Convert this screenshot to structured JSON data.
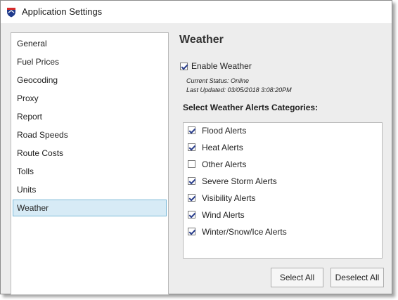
{
  "window": {
    "title": "Application Settings",
    "icon": "shield-logo-icon"
  },
  "sidebar": {
    "items": [
      {
        "label": "General",
        "selected": false
      },
      {
        "label": "Fuel Prices",
        "selected": false
      },
      {
        "label": "Geocoding",
        "selected": false
      },
      {
        "label": "Proxy",
        "selected": false
      },
      {
        "label": "Report",
        "selected": false
      },
      {
        "label": "Road Speeds",
        "selected": false
      },
      {
        "label": "Route Costs",
        "selected": false
      },
      {
        "label": "Tolls",
        "selected": false
      },
      {
        "label": "Units",
        "selected": false
      },
      {
        "label": "Weather",
        "selected": true
      }
    ]
  },
  "weather": {
    "title": "Weather",
    "enable_label": "Enable Weather",
    "enable_checked": true,
    "status": "Current Status: Online",
    "last_updated": "Last Updated: 03/05/2018 3:08:20PM",
    "categories_header": "Select Weather Alerts Categories:",
    "alerts": [
      {
        "label": "Flood Alerts",
        "checked": true
      },
      {
        "label": "Heat Alerts",
        "checked": true
      },
      {
        "label": "Other Alerts",
        "checked": false
      },
      {
        "label": "Severe Storm Alerts",
        "checked": true
      },
      {
        "label": "Visibility Alerts",
        "checked": true
      },
      {
        "label": "Wind Alerts",
        "checked": true
      },
      {
        "label": "Winter/Snow/Ice Alerts",
        "checked": true
      }
    ],
    "select_all_label": "Select All",
    "deselect_all_label": "Deselect All"
  },
  "colors": {
    "selection_bg": "#d7ebf6",
    "selection_border": "#7cb9d8",
    "checkmark": "#2b3f8c"
  }
}
